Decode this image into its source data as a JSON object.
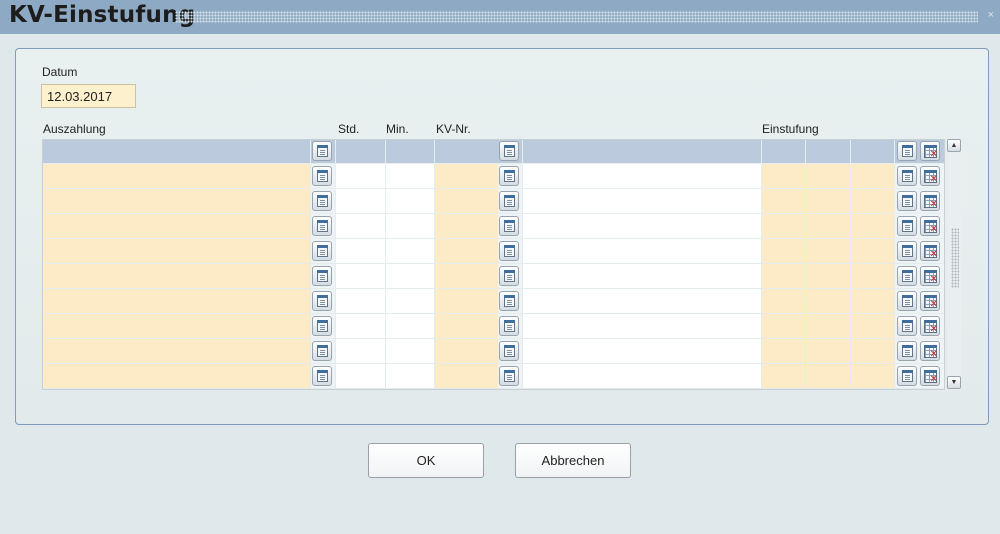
{
  "window": {
    "title": "KV-Einstufung",
    "close_glyph": "×"
  },
  "form": {
    "datum_label": "Datum",
    "datum_value": "12.03.2017"
  },
  "table": {
    "columns": {
      "auszahlung": "Auszahlung",
      "std": "Std.",
      "min": "Min.",
      "kv_nr": "KV-Nr.",
      "einstufung": "Einstufung"
    },
    "data_rows": 9,
    "row_icons": [
      "calendar-list-icon",
      "calendar-list-icon",
      "calendar-list-icon",
      "grid-delete-icon"
    ]
  },
  "scrollbar": {
    "up": "▲",
    "down": "▼"
  },
  "buttons": {
    "ok": "OK",
    "cancel": "Abbrechen"
  },
  "colors": {
    "titlebar": "#8ea9c3",
    "header_row": "#bccadd",
    "editable_cell": "#fdebc8",
    "panel_border": "#7f9dbb"
  }
}
